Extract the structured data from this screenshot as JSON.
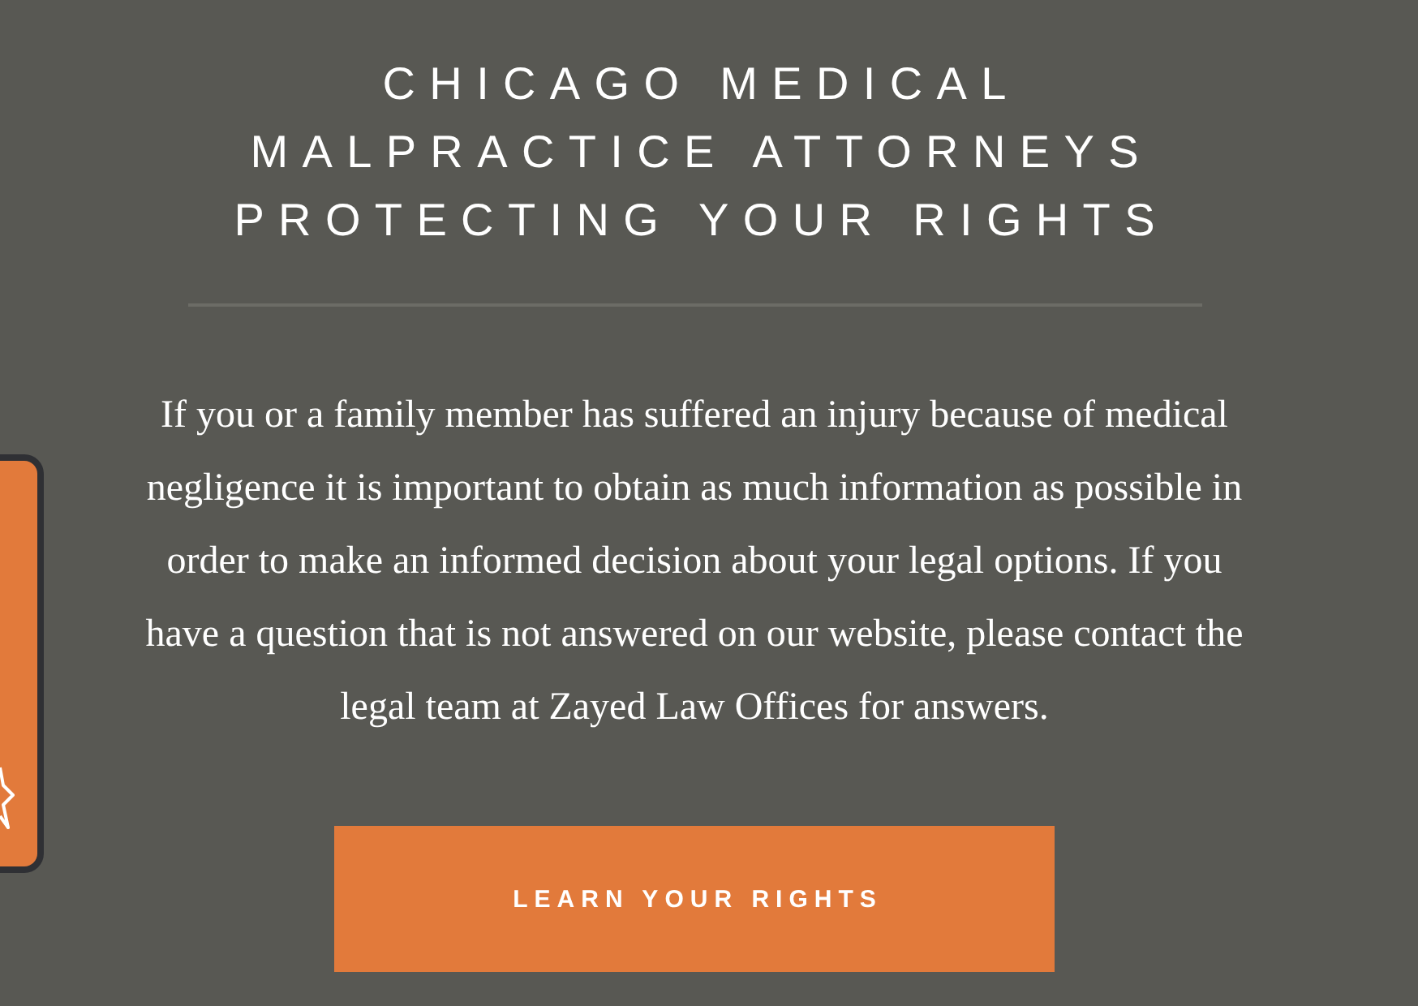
{
  "heading_lines": [
    "CHICAGO MEDICAL",
    "MALPRACTICE ATTORNEYS",
    "PROTECTING YOUR RIGHTS"
  ],
  "intro": "If you or a family member has suffered an injury because of medical negligence it is important to obtain as much information as possible in order to make an informed decision about your legal options. If you have a question that is not answered on our website, please contact the legal team at Zayed Law Offices for answers.",
  "button": {
    "label": "LEARN YOUR RIGHTS"
  }
}
